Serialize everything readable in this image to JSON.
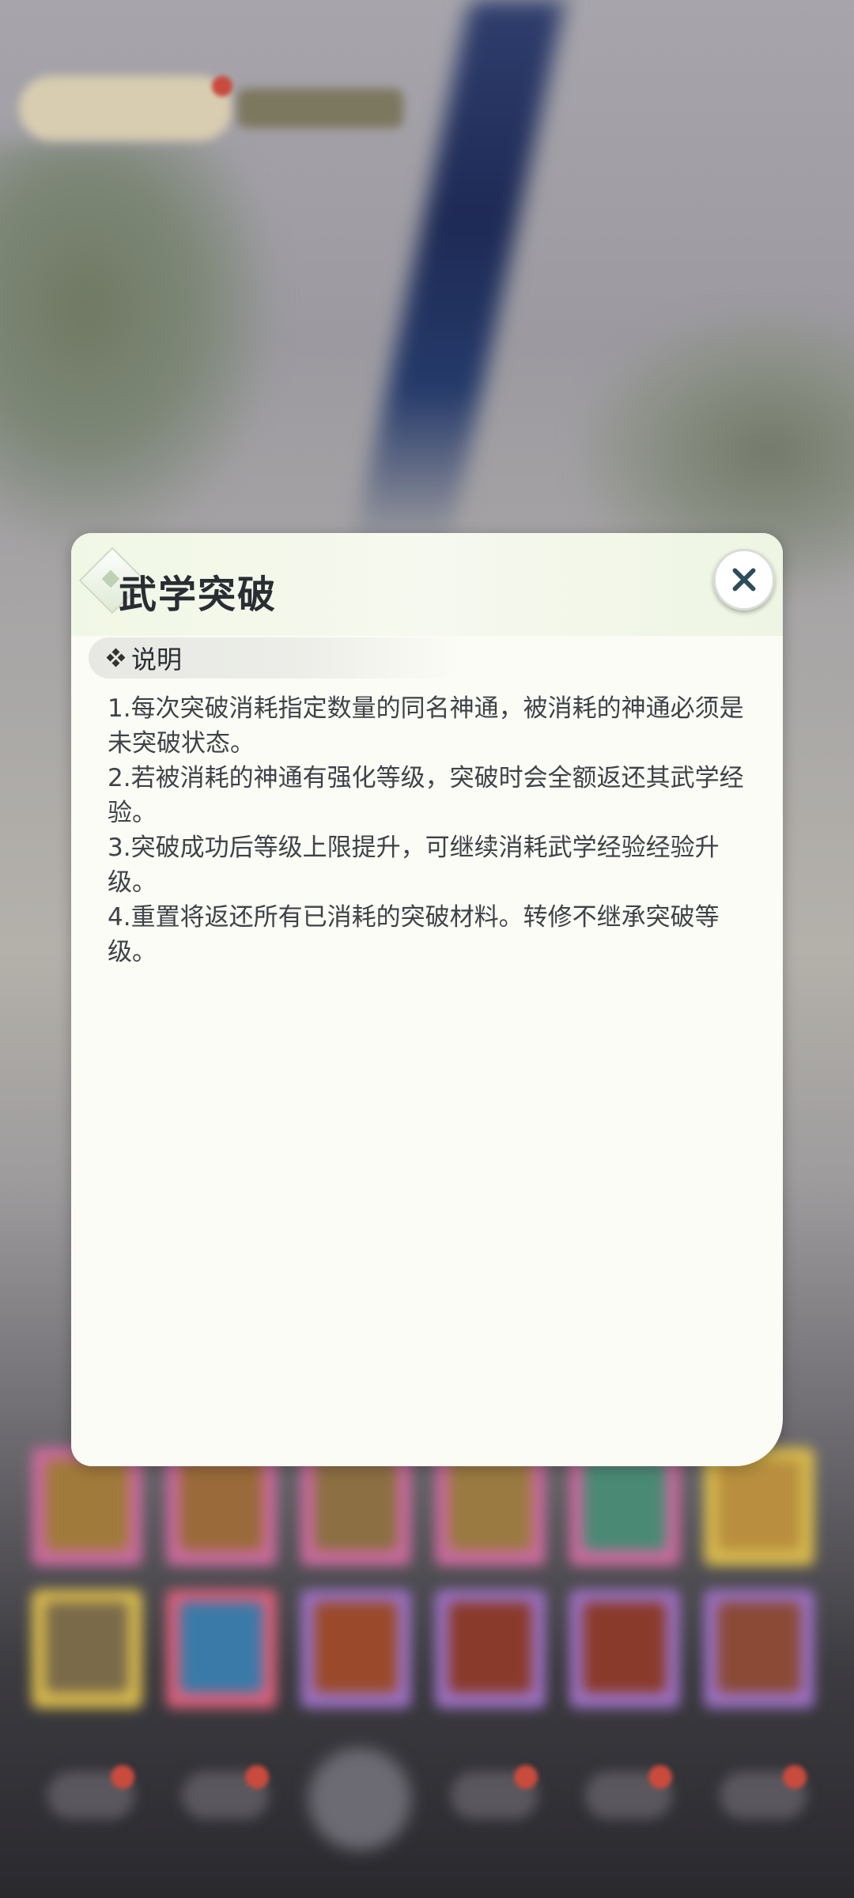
{
  "dialog": {
    "title": "武学突破",
    "close_icon": "close-icon",
    "section_label": "说明",
    "section_icon": "sparkle-diamond-icon",
    "lines": [
      "1.每次突破消耗指定数量的同名神通，被消耗的神通必须是未突破状态。",
      "2.若被消耗的神通有强化等级，突破时会全额返还其武学经验。",
      "3.突破成功后等级上限提升，可继续消耗武学经验经验升级。",
      "4.重置将返还所有已消耗的突破材料。转修不继承突破等级。"
    ]
  },
  "colors": {
    "dialog_bg": "#fbfcf5",
    "title": "#2a2d33",
    "body_text": "#3f4248",
    "close_icon": "#2f4c5a"
  }
}
